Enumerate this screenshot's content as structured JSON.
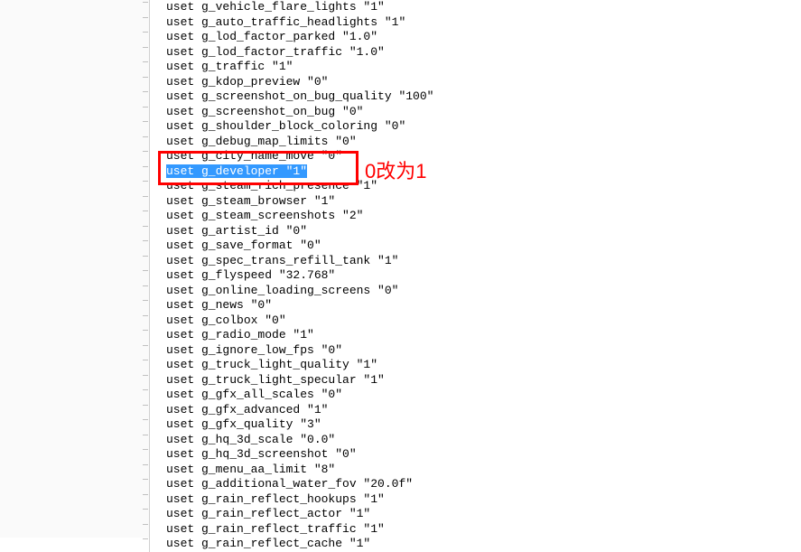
{
  "lines": [
    "uset g_vehicle_flare_lights \"1\"",
    "uset g_auto_traffic_headlights \"1\"",
    "uset g_lod_factor_parked \"1.0\"",
    "uset g_lod_factor_traffic \"1.0\"",
    "uset g_traffic \"1\"",
    "uset g_kdop_preview \"0\"",
    "uset g_screenshot_on_bug_quality \"100\"",
    "uset g_screenshot_on_bug \"0\"",
    "uset g_shoulder_block_coloring \"0\"",
    "uset g_debug_map_limits \"0\"",
    "uset g_city_name_move \"0\"",
    "uset g_developer \"1\"",
    "uset g_steam_rich_presence \"1\"",
    "uset g_steam_browser \"1\"",
    "uset g_steam_screenshots \"2\"",
    "uset g_artist_id \"0\"",
    "uset g_save_format \"0\"",
    "uset g_spec_trans_refill_tank \"1\"",
    "uset g_flyspeed \"32.768\"",
    "uset g_online_loading_screens \"0\"",
    "uset g_news \"0\"",
    "uset g_colbox \"0\"",
    "uset g_radio_mode \"1\"",
    "uset g_ignore_low_fps \"0\"",
    "uset g_truck_light_quality \"1\"",
    "uset g_truck_light_specular \"1\"",
    "uset g_gfx_all_scales \"0\"",
    "uset g_gfx_advanced \"1\"",
    "uset g_gfx_quality \"3\"",
    "uset g_hq_3d_scale \"0.0\"",
    "uset g_hq_3d_screenshot \"0\"",
    "uset g_menu_aa_limit \"8\"",
    "uset g_additional_water_fov \"20.0f\"",
    "uset g_rain_reflect_hookups \"1\"",
    "uset g_rain_reflect_actor \"1\"",
    "uset g_rain_reflect_traffic \"1\"",
    "uset g_rain_reflect_cache \"1\""
  ],
  "selected_line_index": 11,
  "partially_hidden_line_index": 12,
  "annotation_text": "0改为1"
}
